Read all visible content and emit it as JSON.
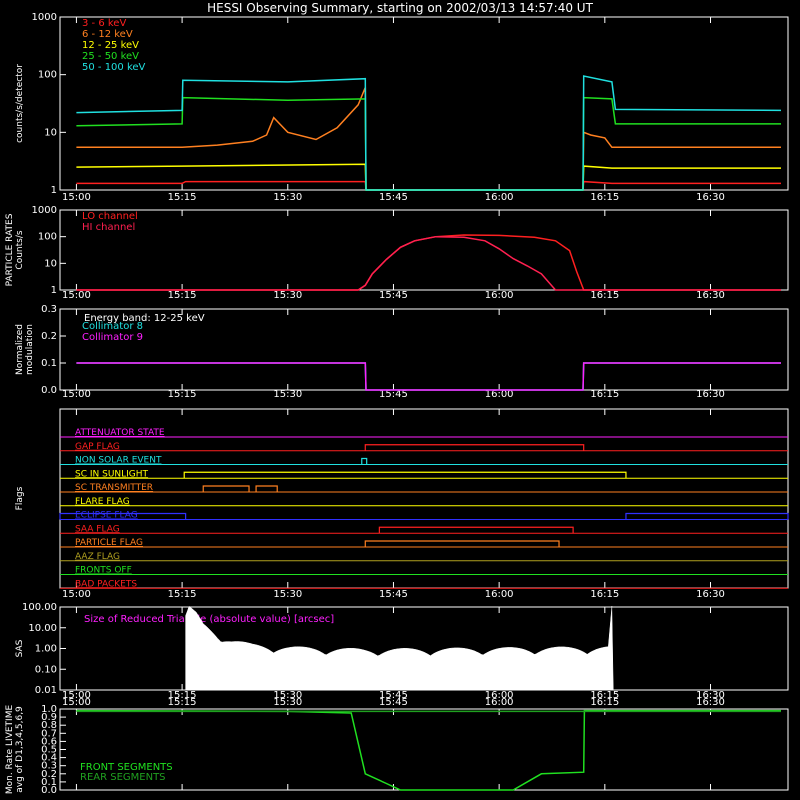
{
  "title": "HESSI Observing Summary, starting on 2002/03/13 14:57:40 UT",
  "x_ticks": [
    "15:00",
    "15:15",
    "15:30",
    "15:45",
    "16:00",
    "16:15",
    "16:30"
  ],
  "colors": {
    "red": "#ff2020",
    "orange": "#ff8020",
    "yellow": "#ffff00",
    "green": "#20e020",
    "cyan": "#20e0e0",
    "magenta": "#ff20ff",
    "crimson": "#ff2050",
    "blue": "#3030ff",
    "darkgreen": "#20a020",
    "olive": "#b0a020"
  },
  "chart_data": [
    {
      "type": "line",
      "name": "count-rates",
      "ylabel": "counts/s/detector",
      "yscale": "log",
      "ylim": [
        1,
        1000
      ],
      "y_ticks": [
        "1",
        "10",
        "100",
        "1000"
      ],
      "xlim_minutes": [
        -2.33,
        101
      ],
      "legend": "top-left",
      "series": [
        {
          "name": "3 - 6 keV",
          "color": "#ff2020",
          "x": [
            0,
            15,
            15.5,
            41,
            41.1,
            71.9,
            72,
            76,
            100
          ],
          "y": [
            1.3,
            1.3,
            1.4,
            1.4,
            1,
            1,
            1.4,
            1.3,
            1.3
          ]
        },
        {
          "name": "6 - 12 keV",
          "color": "#ff8020",
          "x": [
            0,
            15,
            20,
            25,
            27,
            28,
            30,
            34,
            37,
            40,
            41,
            41.1,
            71.9,
            72,
            73,
            75,
            76,
            80,
            100
          ],
          "y": [
            5.5,
            5.5,
            6,
            7,
            9,
            18,
            10,
            7.5,
            12,
            30,
            60,
            1,
            1,
            10,
            9,
            8,
            5.5,
            5.5,
            5.5
          ]
        },
        {
          "name": "12 - 25 keV",
          "color": "#ffff00",
          "x": [
            0,
            15,
            41,
            41.1,
            71.9,
            72,
            76,
            100
          ],
          "y": [
            2.5,
            2.6,
            2.8,
            1,
            1,
            2.6,
            2.4,
            2.4
          ]
        },
        {
          "name": "25 - 50 keV",
          "color": "#20e020",
          "x": [
            0,
            15,
            15.1,
            30,
            41,
            41.1,
            71.9,
            72,
            76,
            76.5,
            100
          ],
          "y": [
            13,
            14,
            40,
            36,
            38,
            1,
            1,
            40,
            38,
            14,
            14
          ]
        },
        {
          "name": "50 - 100 keV",
          "color": "#20e0e0",
          "x": [
            0,
            15,
            15.1,
            30,
            41,
            41.1,
            71.9,
            72,
            76,
            76.5,
            100
          ],
          "y": [
            22,
            24,
            80,
            75,
            85,
            1,
            1,
            95,
            75,
            25,
            24
          ]
        }
      ]
    },
    {
      "type": "line",
      "name": "particle-rates",
      "ylabel": "PARTICLE RATES Counts/s",
      "yscale": "log",
      "ylim": [
        1,
        1000
      ],
      "y_ticks": [
        "1",
        "10",
        "100",
        "1000"
      ],
      "xlim_minutes": [
        -2.33,
        101
      ],
      "legend": "top-left",
      "series": [
        {
          "name": "LO channel",
          "color": "#ff2020",
          "x": [
            0,
            40,
            41,
            42,
            44,
            46,
            48,
            51,
            55,
            60,
            65,
            68,
            70,
            71,
            72,
            73,
            100
          ],
          "y": [
            1,
            1,
            1.5,
            4,
            14,
            40,
            70,
            100,
            115,
            112,
            95,
            70,
            30,
            5,
            1,
            1,
            1
          ]
        },
        {
          "name": "HI channel",
          "color": "#ff2050",
          "x": [
            0,
            40,
            41,
            42,
            44,
            46,
            48,
            51,
            55,
            58,
            60,
            62,
            64,
            66,
            67,
            68,
            100
          ],
          "y": [
            1,
            1,
            1.5,
            4,
            14,
            40,
            70,
            100,
            95,
            70,
            35,
            15,
            8,
            4,
            2,
            1,
            1
          ]
        }
      ]
    },
    {
      "type": "line",
      "name": "modulation",
      "ylabel": "Normalized modulation",
      "annotation": "Energy band: 12-25 keV",
      "ylim": [
        0,
        0.3
      ],
      "y_ticks": [
        "0.0",
        "0.1",
        "0.2",
        "0.3"
      ],
      "xlim_minutes": [
        -2.33,
        101
      ],
      "legend": "top-left",
      "series": [
        {
          "name": "Collimator 8",
          "color": "#20e0e0",
          "x": [
            0,
            41,
            41.1,
            71.9,
            72,
            100
          ],
          "y": [
            0.1,
            0.1,
            0,
            0,
            0.1,
            0.1
          ]
        },
        {
          "name": "Collimator 9",
          "color": "#ff20ff",
          "x": [
            0,
            41,
            41.1,
            71.9,
            72,
            100
          ],
          "y": [
            0.1,
            0.1,
            0,
            0,
            0.1,
            0.1
          ]
        }
      ]
    },
    {
      "type": "line",
      "name": "flags",
      "ylabel": "Flags",
      "xlim_minutes": [
        -2.33,
        101
      ],
      "series": [
        {
          "name": "ATTENUATOR STATE",
          "color": "#ff20ff",
          "segments": [
            [
              0,
              0
            ]
          ]
        },
        {
          "name": "GAP FLAG",
          "color": "#ff2020",
          "segments": [
            [
              41,
              72
            ]
          ]
        },
        {
          "name": "NON SOLAR EVENT",
          "color": "#20e0e0",
          "segments": [
            [
              40.5,
              41.2
            ]
          ]
        },
        {
          "name": "SC IN SUNLIGHT",
          "color": "#ffff00",
          "segments": [
            [
              15.3,
              78
            ]
          ]
        },
        {
          "name": "SC TRANSMITTER",
          "color": "#ff8020",
          "segments": [
            [
              18,
              24.5
            ],
            [
              25.5,
              28.5
            ]
          ]
        },
        {
          "name": "FLARE FLAG",
          "color": "#ffff00",
          "segments": []
        },
        {
          "name": "ECLIPSE FLAG",
          "color": "#3030ff",
          "segments": [
            [
              -3,
              15.5
            ],
            [
              78,
              101
            ]
          ]
        },
        {
          "name": "SAA FLAG",
          "color": "#ff2020",
          "segments": [
            [
              43,
              70.5
            ]
          ]
        },
        {
          "name": "PARTICLE FLAG",
          "color": "#ff8020",
          "segments": [
            [
              41,
              68.5
            ]
          ]
        },
        {
          "name": "AAZ FLAG",
          "color": "#b0a020",
          "segments": []
        },
        {
          "name": "FRONTS OFF",
          "color": "#20e020",
          "segments": []
        },
        {
          "name": "BAD PACKETS",
          "color": "#ff2020",
          "segments": []
        }
      ]
    },
    {
      "type": "area",
      "name": "sas",
      "ylabel": "SAS",
      "yscale": "log",
      "annotation": "Size of Reduced Triangle (absolute value) [arcsec]",
      "ylim": [
        0.01,
        100
      ],
      "y_ticks": [
        "0.01",
        "0.10",
        "1.00",
        "10.00",
        "100.00"
      ],
      "xlim_minutes": [
        -2.33,
        101
      ],
      "series": [
        {
          "name": "triangle",
          "color": "#ffffff",
          "x": [
            15.5,
            16,
            17,
            18,
            20,
            22,
            25,
            30,
            41,
            60,
            75.5,
            76,
            76.2
          ],
          "y": [
            30,
            80,
            40,
            12,
            4,
            2,
            1.2,
            0.9,
            0.7,
            0.8,
            0.9,
            80,
            0.01
          ]
        }
      ]
    },
    {
      "type": "line",
      "name": "livetime",
      "ylabel": "Mon. Rate LIVETIME avg of D1,3,4,5,6,9",
      "ylim": [
        0,
        1
      ],
      "y_ticks": [
        "0.0",
        "0.1",
        "0.2",
        "0.3",
        "0.4",
        "0.5",
        "0.6",
        "0.7",
        "0.8",
        "0.9",
        "1.0"
      ],
      "xlim_minutes": [
        -2.33,
        101
      ],
      "legend": "bottom-left",
      "series": [
        {
          "name": "FRONT SEGMENTS",
          "color": "#20e020",
          "x": [
            0,
            30,
            39,
            41,
            41.5,
            44,
            46,
            46.1,
            62,
            66,
            72,
            72.1,
            100
          ],
          "y": [
            0.98,
            0.97,
            0.95,
            0.2,
            0.18,
            0.08,
            0,
            0,
            0,
            0.2,
            0.22,
            0.98,
            0.98
          ]
        },
        {
          "name": "REAR SEGMENTS",
          "color": "#20a020",
          "x": [
            0,
            41,
            72,
            100
          ],
          "y": [
            0.97,
            0.97,
            0.97,
            0.97
          ]
        }
      ]
    }
  ]
}
